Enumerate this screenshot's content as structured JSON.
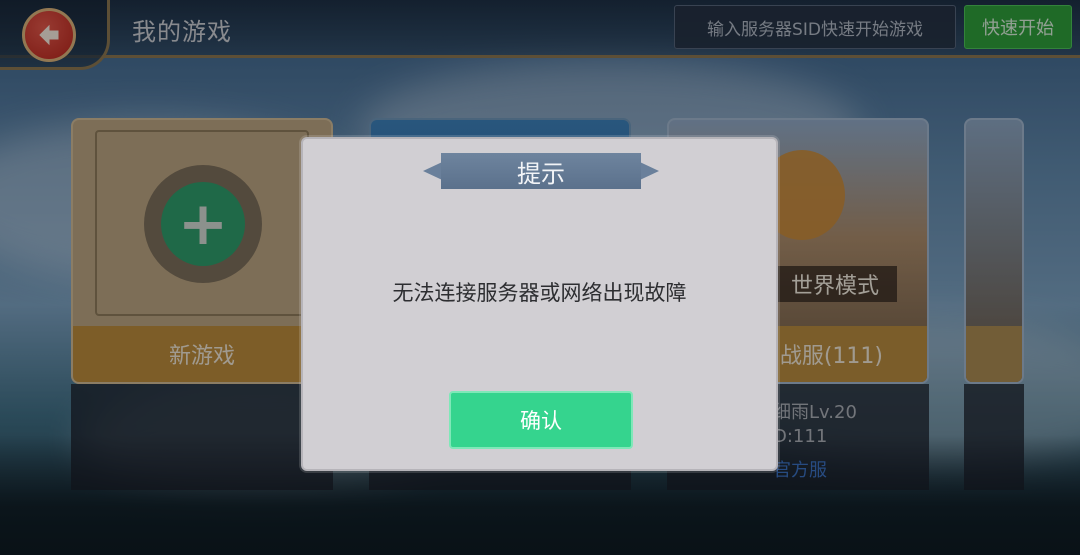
{
  "header": {
    "title": "我的游戏",
    "sid_placeholder": "输入服务器SID快速开始游戏",
    "quick_start": "快速开始"
  },
  "cards": [
    {
      "label": "新游戏"
    },
    {
      "label": ""
    },
    {
      "mode": "世界模式",
      "label": "战服(111)",
      "player": "细雨Lv.20",
      "sid": "D:111",
      "server_type": "官方服"
    },
    {
      "label": ""
    }
  ],
  "dialog": {
    "title": "提示",
    "message": "无法连接服务器或网络出现故障",
    "confirm": "确认"
  },
  "colors": {
    "back_button": "#c0302a",
    "quick_start": "#2e9d3a",
    "confirm": "#35d48e",
    "dialog_bg": "#d1cfd3"
  }
}
